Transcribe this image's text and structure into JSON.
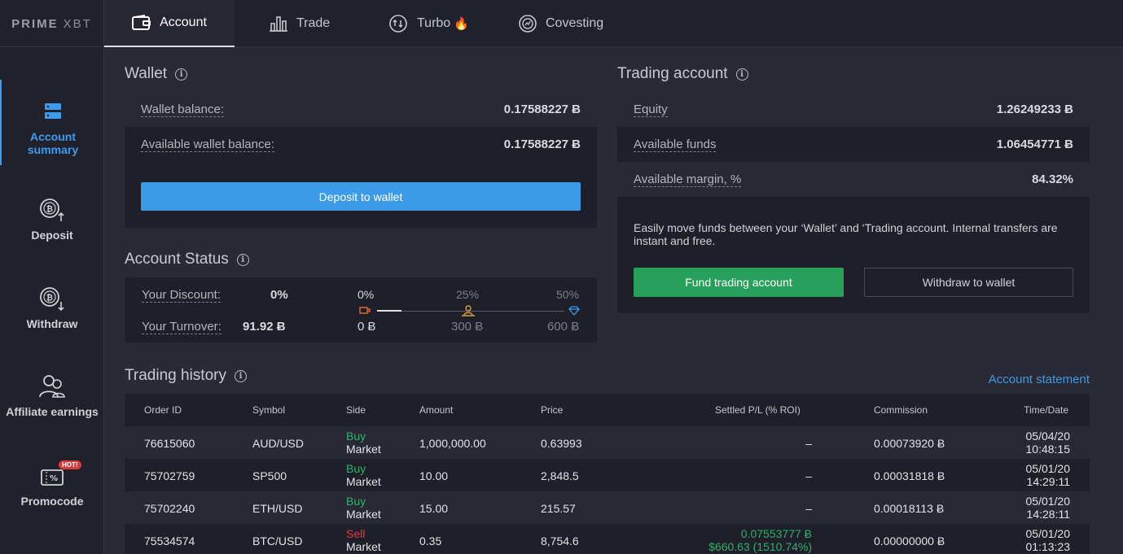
{
  "logo": {
    "bold": "PRIME",
    "light": "XBT"
  },
  "tabs": [
    {
      "label": "Account",
      "icon": "wallet-icon",
      "active": true
    },
    {
      "label": "Trade",
      "icon": "bar-chart-icon"
    },
    {
      "label": "Turbo",
      "icon": "turbo-icon",
      "badge": "🔥"
    },
    {
      "label": "Covesting",
      "icon": "covesting-icon"
    }
  ],
  "sidebar": [
    {
      "label": "Account summary",
      "icon": "server-stack-icon",
      "active": true
    },
    {
      "label": "Deposit",
      "icon": "bitcoin-deposit-icon"
    },
    {
      "label": "Withdraw",
      "icon": "bitcoin-withdraw-icon"
    },
    {
      "label": "Affiliate earnings",
      "icon": "affiliate-users-icon"
    },
    {
      "label": "Promocode",
      "icon": "ticket-percent-icon",
      "badge": "HOT!"
    }
  ],
  "wallet": {
    "title": "Wallet",
    "balance_label": "Wallet balance:",
    "balance_value": "0.17588227 Ƀ",
    "available_label": "Available wallet balance:",
    "available_value": "0.17588227 Ƀ",
    "deposit_button": "Deposit to wallet"
  },
  "trading_account": {
    "title": "Trading account",
    "equity_label": "Equity",
    "equity_value": "1.26249233 Ƀ",
    "funds_label": "Available funds",
    "funds_value": "1.06454771 Ƀ",
    "margin_label": "Available margin, %",
    "margin_value": "84.32%",
    "note": "Easily move funds between your ‘Wallet’ and ‘Trading account. Internal transfers are instant and free.",
    "fund_button": "Fund trading account",
    "withdraw_button": "Withdraw to wallet"
  },
  "account_status": {
    "title": "Account Status",
    "discount_label": "Your Discount:",
    "discount_value": "0%",
    "turnover_label": "Your Turnover:",
    "turnover_value": "91.92 Ƀ",
    "tiers": [
      {
        "pct": "0%",
        "amount": "0 Ƀ",
        "icon": "bronze-tier-icon"
      },
      {
        "pct": "25%",
        "amount": "300 Ƀ",
        "icon": "gold-tier-icon"
      },
      {
        "pct": "50%",
        "amount": "600 Ƀ",
        "icon": "diamond-tier-icon"
      }
    ]
  },
  "history": {
    "title": "Trading history",
    "statement_link": "Account statement",
    "columns": [
      "Order ID",
      "Symbol",
      "Side",
      "Amount",
      "Price",
      "Settled P/L (% ROI)",
      "Commission",
      "Time/Date"
    ],
    "rows": [
      {
        "id": "76615060",
        "symbol": "AUD/USD",
        "side": "Buy",
        "type": "Market",
        "amount": "1,000,000.00",
        "price": "0.63993",
        "pl1": "–",
        "pl2": "",
        "commission": "0.00073920 Ƀ",
        "date": "05/04/20",
        "time": "10:48:15"
      },
      {
        "id": "75702759",
        "symbol": "SP500",
        "side": "Buy",
        "type": "Market",
        "amount": "10.00",
        "price": "2,848.5",
        "pl1": "–",
        "pl2": "",
        "commission": "0.00031818 Ƀ",
        "date": "05/01/20",
        "time": "14:29:11"
      },
      {
        "id": "75702240",
        "symbol": "ETH/USD",
        "side": "Buy",
        "type": "Market",
        "amount": "15.00",
        "price": "215.57",
        "pl1": "–",
        "pl2": "",
        "commission": "0.00018113 Ƀ",
        "date": "05/01/20",
        "time": "14:28:11"
      },
      {
        "id": "75534574",
        "symbol": "BTC/USD",
        "side": "Sell",
        "type": "Market",
        "amount": "0.35",
        "price": "8,754.6",
        "pl1": "0.07553777 Ƀ",
        "pl2": "$660.63 (1510.74%)",
        "commission": "0.00000000 Ƀ",
        "date": "05/01/20",
        "time": "01:13:23"
      }
    ]
  },
  "colors": {
    "accent": "#3b9be8",
    "green": "#26a05a",
    "buy": "#2bb36a",
    "sell": "#e23b3b"
  }
}
